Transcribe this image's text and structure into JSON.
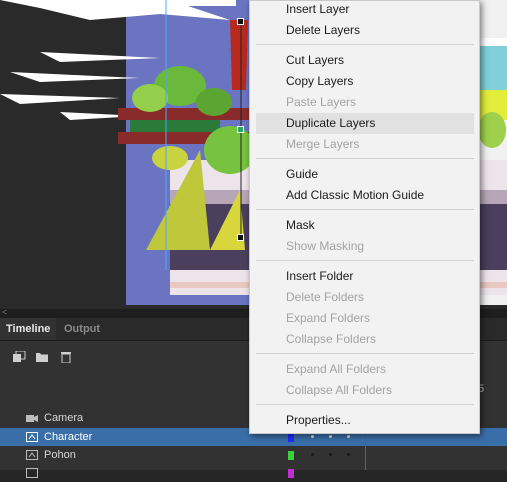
{
  "colors": {
    "menu_bg": "#f2f2f2",
    "selection": "#3a6ea8",
    "camera_layer": "#5a5a5a",
    "character_layer": "#1d2cff",
    "pohon_layer": "#3bd13b",
    "last_layer": "#c02ed0",
    "playhead": "#cc3333"
  },
  "stage": {
    "scroll_left_glyph": "<"
  },
  "timeline": {
    "tabs": [
      {
        "label": "Timeline",
        "active": true
      },
      {
        "label": "Output",
        "active": false
      }
    ],
    "toolbar_icons": [
      "new-layer-icon",
      "new-folder-icon",
      "trash-icon"
    ],
    "frame_ruler_label": "5",
    "layers": [
      {
        "name": "Camera",
        "icon": "camera-icon",
        "selected": false
      },
      {
        "name": "Character",
        "icon": "layer-icon",
        "selected": true
      },
      {
        "name": "Pohon",
        "icon": "layer-icon",
        "selected": false
      },
      {
        "name": "",
        "icon": "layer-icon",
        "selected": false
      }
    ]
  },
  "context_menu": {
    "items": [
      {
        "label": "Insert Layer",
        "enabled": true
      },
      {
        "label": "Delete Layers",
        "enabled": true
      },
      {
        "separator": true
      },
      {
        "label": "Cut Layers",
        "enabled": true
      },
      {
        "label": "Copy Layers",
        "enabled": true
      },
      {
        "label": "Paste Layers",
        "enabled": false
      },
      {
        "label": "Duplicate Layers",
        "enabled": true,
        "hovered": true
      },
      {
        "label": "Merge Layers",
        "enabled": false
      },
      {
        "separator": true
      },
      {
        "label": "Guide",
        "enabled": true
      },
      {
        "label": "Add Classic Motion Guide",
        "enabled": true
      },
      {
        "separator": true
      },
      {
        "label": "Mask",
        "enabled": true
      },
      {
        "label": "Show Masking",
        "enabled": false
      },
      {
        "separator": true
      },
      {
        "label": "Insert Folder",
        "enabled": true
      },
      {
        "label": "Delete Folders",
        "enabled": false
      },
      {
        "label": "Expand Folders",
        "enabled": false
      },
      {
        "label": "Collapse Folders",
        "enabled": false
      },
      {
        "separator": true
      },
      {
        "label": "Expand All Folders",
        "enabled": false
      },
      {
        "label": "Collapse All Folders",
        "enabled": false
      },
      {
        "separator": true
      },
      {
        "label": "Properties...",
        "enabled": true
      }
    ]
  }
}
